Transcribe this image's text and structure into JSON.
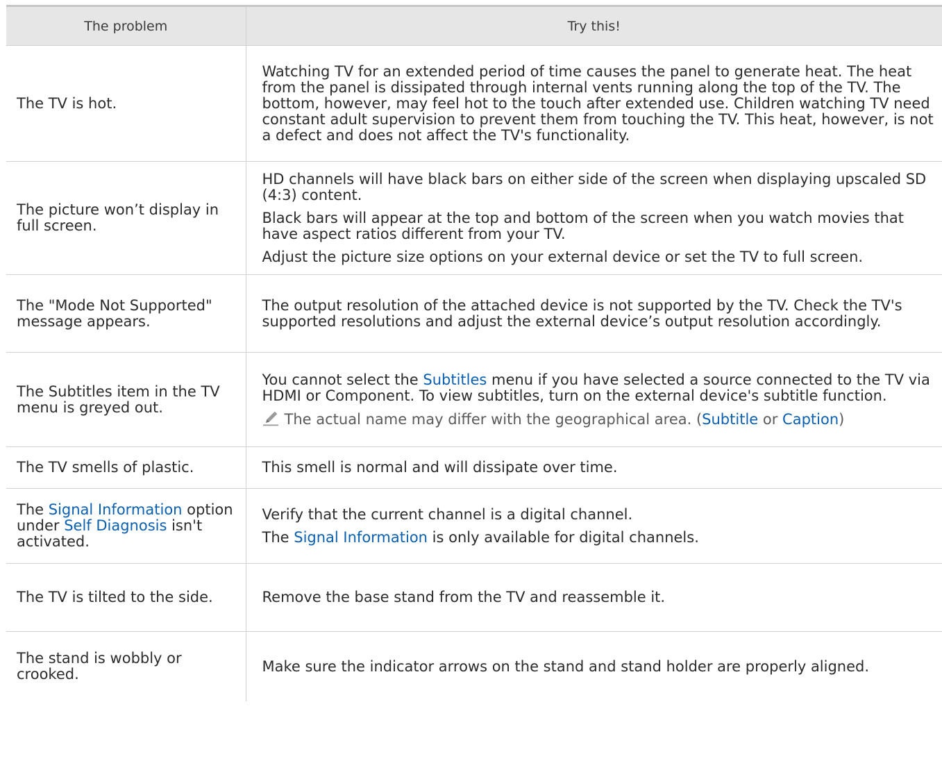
{
  "headers": {
    "problem": "The problem",
    "try": "Try this!"
  },
  "colors": {
    "highlight": "#0b5fb0",
    "header_bg": "#e6e6e6",
    "border": "#d0d0d0",
    "note_text": "#5a5a5a"
  },
  "note_icon": "pencil-icon",
  "rows": {
    "hot": {
      "problem": "The TV is hot.",
      "solution": "Watching TV for an extended period of time causes the panel to generate heat. The heat from the panel is dissipated through internal vents running along the top of the TV. The bottom, however, may feel hot to the touch after extended use. Children watching TV need constant adult supervision to prevent them from touching the TV. This heat, however, is not a defect and does not affect the TV's functionality."
    },
    "picture": {
      "problem": "The picture won’t display in full screen.",
      "solution_1": "HD channels will have black bars on either side of the screen when displaying upscaled SD (4:3) content.",
      "solution_2": "Black bars will appear at the top and bottom of the screen when you watch movies that have aspect ratios different from your TV.",
      "solution_3": "Adjust the picture size options on your external device or set the TV to full screen."
    },
    "mode": {
      "problem": "The \"Mode Not Supported\" message appears.",
      "solution": "The output resolution of the attached device is not supported by the TV. Check the TV's supported resolutions and adjust the external device’s output resolution accordingly."
    },
    "subtitles": {
      "problem": "The Subtitles item in the TV menu is greyed out.",
      "solution_pre": "You cannot select the ",
      "solution_link": "Subtitles",
      "solution_post": " menu if you have selected a source connected to the TV via HDMI or Component. To view subtitles, turn on the external device's subtitle function.",
      "note_pre": "The actual name may differ with the geographical area. (",
      "note_link_1": "Subtitle",
      "note_mid": " or ",
      "note_link_2": "Caption",
      "note_post": ")"
    },
    "smell": {
      "problem": "The TV smells of plastic.",
      "solution": "This smell is normal and will dissipate over time."
    },
    "signal": {
      "problem_pre": "The ",
      "problem_link_1": "Signal Information",
      "problem_mid": " option under ",
      "problem_link_2": "Self Diagnosis",
      "problem_post": " isn't activated.",
      "solution_1": "Verify that the current channel is a digital channel.",
      "solution_2_pre": "The ",
      "solution_2_link": "Signal Information",
      "solution_2_post": " is only available for digital channels."
    },
    "tilt": {
      "problem": "The TV is tilted to the side.",
      "solution": "Remove the base stand from the TV and reassemble it."
    },
    "stand": {
      "problem": "The stand is wobbly or crooked.",
      "solution": "Make sure the indicator arrows on the stand and stand holder are properly aligned."
    }
  }
}
